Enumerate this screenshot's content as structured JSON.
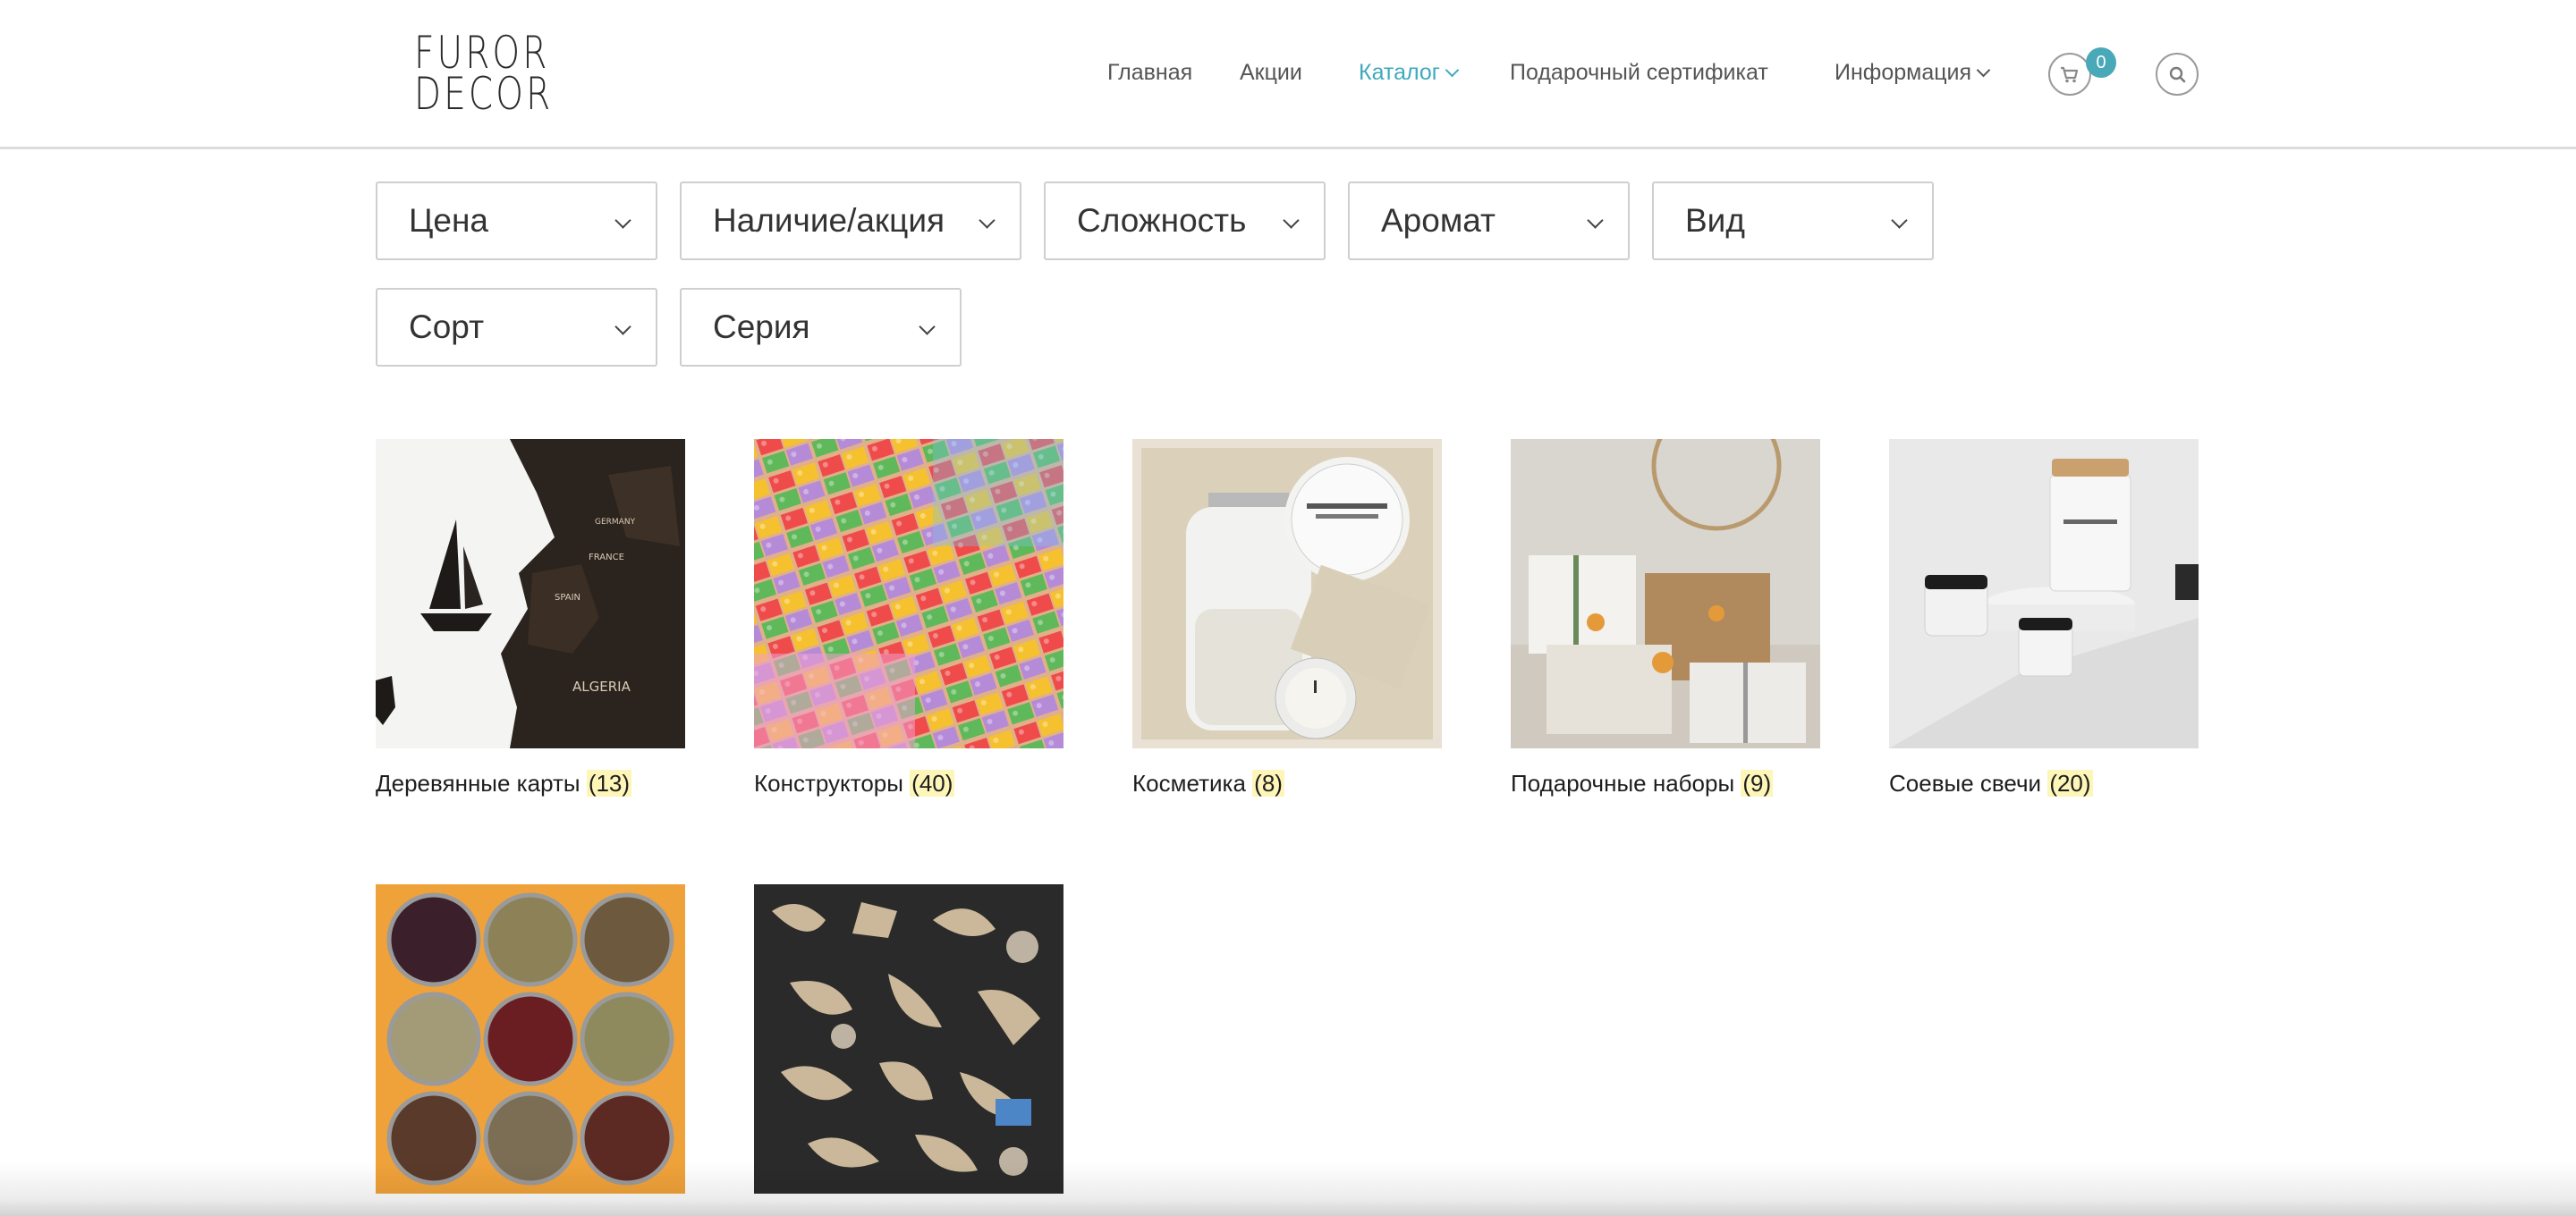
{
  "brand": {
    "logo_line1": "FUROR",
    "logo_line2": "DECOR"
  },
  "nav": {
    "items": [
      {
        "label": "Главная"
      },
      {
        "label": "Акции"
      },
      {
        "label": "Каталог",
        "active": true
      },
      {
        "label": "Подарочный сертификат"
      },
      {
        "label": "Информация"
      }
    ],
    "cart_count": "0",
    "accent_color": "#3fa9be"
  },
  "filters": [
    {
      "label": "Цена"
    },
    {
      "label": "Наличие/акция"
    },
    {
      "label": "Сложность"
    },
    {
      "label": "Аромат"
    },
    {
      "label": "Вид"
    },
    {
      "label": "Сорт"
    },
    {
      "label": "Серия"
    }
  ],
  "categories": [
    {
      "name": "Деревянные карты",
      "count": "(13)",
      "image": "wooden-world-map"
    },
    {
      "name": "Конструкторы",
      "count": "(40)",
      "image": "colorful-bricks"
    },
    {
      "name": "Косметика",
      "count": "(8)",
      "image": "cosmetics-gift-box"
    },
    {
      "name": "Подарочные наборы",
      "count": "(9)",
      "image": "wrapped-gifts"
    },
    {
      "name": "Соевые свечи",
      "count": "(20)",
      "image": "soy-candles"
    },
    {
      "name": "",
      "count": "",
      "image": "tea-tins"
    },
    {
      "name": "",
      "count": "",
      "image": "wooden-puzzle-pieces"
    }
  ]
}
